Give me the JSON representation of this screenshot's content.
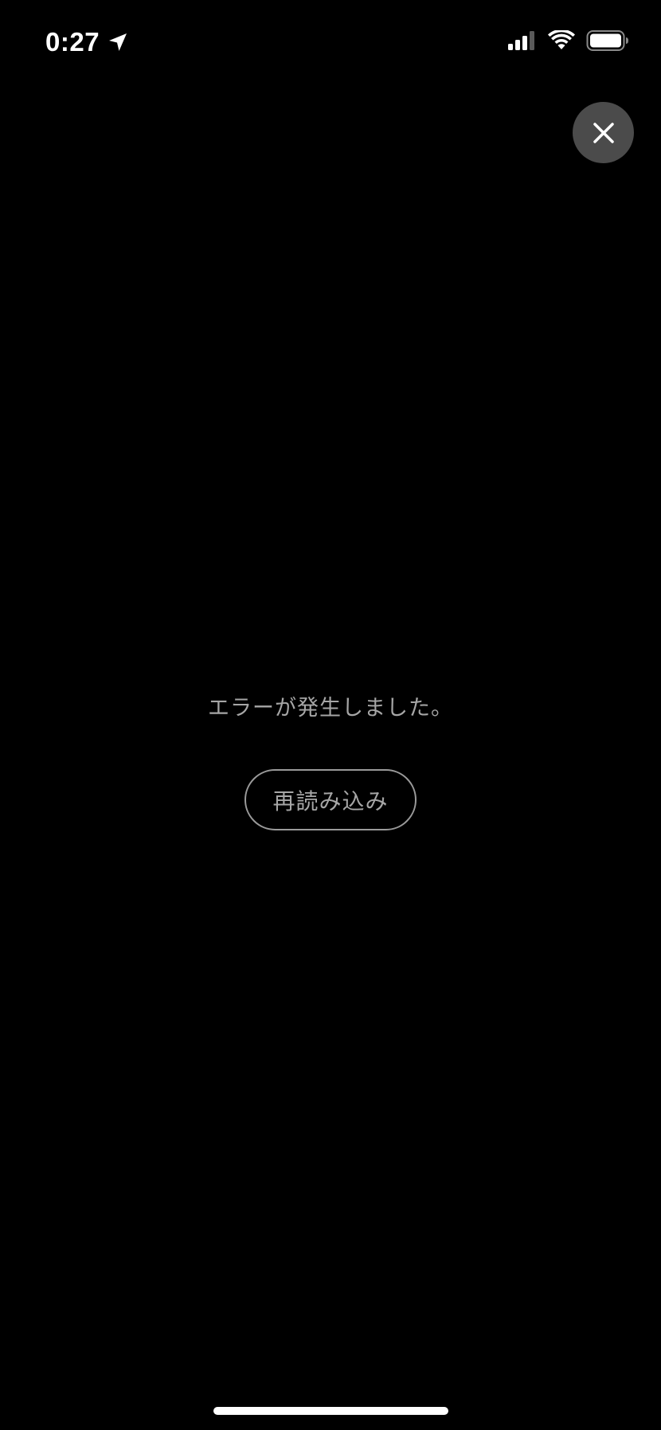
{
  "status_bar": {
    "time": "0:27",
    "location_icon": "location-arrow-icon",
    "signal_icon": "cellular-signal-icon",
    "wifi_icon": "wifi-icon",
    "battery_icon": "battery-icon"
  },
  "close_button": {
    "icon": "close-icon",
    "background_color": "#4b4b4b"
  },
  "error": {
    "message": "エラーが発生しました。",
    "reload_label": "再読み込み"
  },
  "colors": {
    "background": "#000000",
    "text_muted": "#a6a6a6",
    "button_border": "#9a9a9a",
    "home_indicator": "#ffffff"
  }
}
